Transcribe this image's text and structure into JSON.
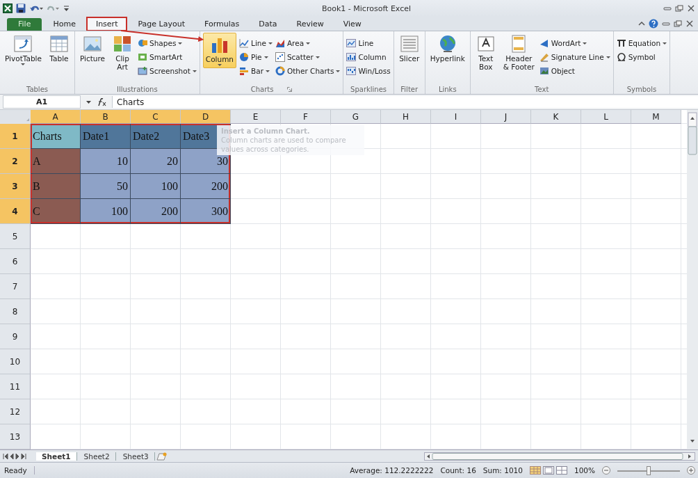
{
  "window": {
    "title": "Book1 - Microsoft Excel"
  },
  "tabs": [
    {
      "label": "File",
      "kind": "file",
      "selected": false,
      "annotated": false
    },
    {
      "label": "Home",
      "kind": "tab",
      "selected": false,
      "annotated": false
    },
    {
      "label": "Insert",
      "kind": "tab",
      "selected": true,
      "annotated": true
    },
    {
      "label": "Page Layout",
      "kind": "tab",
      "selected": false,
      "annotated": false
    },
    {
      "label": "Formulas",
      "kind": "tab",
      "selected": false,
      "annotated": false
    },
    {
      "label": "Data",
      "kind": "tab",
      "selected": false,
      "annotated": false
    },
    {
      "label": "Review",
      "kind": "tab",
      "selected": false,
      "annotated": false
    },
    {
      "label": "View",
      "kind": "tab",
      "selected": false,
      "annotated": false
    }
  ],
  "ribbon": [
    {
      "label": "Tables",
      "items": [
        {
          "kind": "large",
          "label": "PivotTable",
          "dropdown": true,
          "highlighted": false
        },
        {
          "kind": "large",
          "label": "Table",
          "dropdown": false,
          "highlighted": false
        }
      ]
    },
    {
      "label": "Illustrations",
      "items": [
        {
          "kind": "large",
          "label": "Picture",
          "dropdown": false,
          "highlighted": false
        },
        {
          "kind": "large",
          "label": "Clip\nArt",
          "dropdown": false,
          "highlighted": false
        },
        {
          "kind": "stack",
          "buttons": [
            {
              "label": "Shapes",
              "dropdown": true
            },
            {
              "label": "SmartArt",
              "dropdown": false
            },
            {
              "label": "Screenshot",
              "dropdown": true
            }
          ]
        }
      ]
    },
    {
      "label": "Charts",
      "items": [
        {
          "kind": "large",
          "label": "Column",
          "dropdown": true,
          "highlighted": true
        },
        {
          "kind": "stack",
          "buttons": [
            {
              "label": "Line",
              "dropdown": true
            },
            {
              "label": "Pie",
              "dropdown": true
            },
            {
              "label": "Bar",
              "dropdown": true
            }
          ]
        },
        {
          "kind": "stack",
          "buttons": [
            {
              "label": "Area",
              "dropdown": true
            },
            {
              "label": "Scatter",
              "dropdown": true
            },
            {
              "label": "Other Charts",
              "dropdown": true
            }
          ]
        }
      ]
    },
    {
      "label": "Sparklines",
      "items": [
        {
          "kind": "stack",
          "buttons": [
            {
              "label": "Line",
              "dropdown": false
            },
            {
              "label": "Column",
              "dropdown": false
            },
            {
              "label": "Win/Loss",
              "dropdown": false
            }
          ]
        }
      ]
    },
    {
      "label": "Filter",
      "items": [
        {
          "kind": "large",
          "label": "Slicer",
          "dropdown": false,
          "highlighted": false
        }
      ]
    },
    {
      "label": "Links",
      "items": [
        {
          "kind": "large",
          "label": "Hyperlink",
          "dropdown": false,
          "highlighted": false
        }
      ]
    },
    {
      "label": "Text",
      "items": [
        {
          "kind": "large",
          "label": "Text\nBox",
          "dropdown": false,
          "highlighted": false
        },
        {
          "kind": "large",
          "label": "Header\n& Footer",
          "dropdown": false,
          "highlighted": false
        },
        {
          "kind": "stack",
          "buttons": [
            {
              "label": "WordArt",
              "dropdown": true
            },
            {
              "label": "Signature Line",
              "dropdown": true
            },
            {
              "label": "Object",
              "dropdown": false
            }
          ]
        }
      ]
    },
    {
      "label": "Symbols",
      "items": [
        {
          "kind": "stack",
          "buttons": [
            {
              "label": "Equation",
              "dropdown": true
            },
            {
              "label": "Symbol",
              "dropdown": false
            }
          ]
        }
      ]
    }
  ],
  "formula_bar": {
    "name_box": "A1",
    "value": "Charts"
  },
  "tooltip": {
    "title": "Insert a Column Chart.",
    "body": "Column charts are used to compare values across categories."
  },
  "sheet": {
    "columns": [
      {
        "label": "A",
        "selected": true
      },
      {
        "label": "B",
        "selected": true
      },
      {
        "label": "C",
        "selected": true
      },
      {
        "label": "D",
        "selected": true
      },
      {
        "label": "E",
        "selected": false
      },
      {
        "label": "F",
        "selected": false
      },
      {
        "label": "G",
        "selected": false
      },
      {
        "label": "H",
        "selected": false
      },
      {
        "label": "I",
        "selected": false
      },
      {
        "label": "J",
        "selected": false
      },
      {
        "label": "K",
        "selected": false
      },
      {
        "label": "L",
        "selected": false
      },
      {
        "label": "M",
        "selected": false
      }
    ],
    "rows": [
      {
        "label": "1",
        "selected": true,
        "cells": [
          {
            "text": "Charts",
            "color": "#7fb9c6"
          },
          {
            "text": "Date1",
            "color": "#50769a"
          },
          {
            "text": "Date2",
            "color": "#50769a"
          },
          {
            "text": "Date3",
            "color": "#50769a"
          }
        ]
      },
      {
        "label": "2",
        "selected": true,
        "cells": [
          {
            "text": "A",
            "color": "#8b5b52"
          },
          {
            "text": "10",
            "color": "#8ea2c7"
          },
          {
            "text": "20",
            "color": "#8ea2c7"
          },
          {
            "text": "30",
            "color": "#8ea2c7"
          }
        ]
      },
      {
        "label": "3",
        "selected": true,
        "cells": [
          {
            "text": "B",
            "color": "#8b5b52"
          },
          {
            "text": "50",
            "color": "#8ea2c7"
          },
          {
            "text": "100",
            "color": "#8ea2c7"
          },
          {
            "text": "200",
            "color": "#8ea2c7"
          }
        ]
      },
      {
        "label": "4",
        "selected": true,
        "cells": [
          {
            "text": "C",
            "color": "#8b5b52"
          },
          {
            "text": "100",
            "color": "#8ea2c7"
          },
          {
            "text": "200",
            "color": "#8ea2c7"
          },
          {
            "text": "300",
            "color": "#8ea2c7"
          }
        ]
      },
      {
        "label": "5",
        "selected": false,
        "cells": []
      },
      {
        "label": "6",
        "selected": false,
        "cells": []
      },
      {
        "label": "7",
        "selected": false,
        "cells": []
      },
      {
        "label": "8",
        "selected": false,
        "cells": []
      },
      {
        "label": "9",
        "selected": false,
        "cells": []
      },
      {
        "label": "10",
        "selected": false,
        "cells": []
      },
      {
        "label": "11",
        "selected": false,
        "cells": []
      },
      {
        "label": "12",
        "selected": false,
        "cells": []
      },
      {
        "label": "13",
        "selected": false,
        "cells": []
      }
    ]
  },
  "sheet_tabs": [
    {
      "label": "Sheet1",
      "selected": true
    },
    {
      "label": "Sheet2",
      "selected": false
    },
    {
      "label": "Sheet3",
      "selected": false
    }
  ],
  "status_bar": {
    "state": "Ready",
    "average": "Average: 112.2222222",
    "count": "Count: 16",
    "sum": "Sum: 1010",
    "zoom": "100%",
    "zoom_slider": {
      "level": 0.5
    }
  }
}
